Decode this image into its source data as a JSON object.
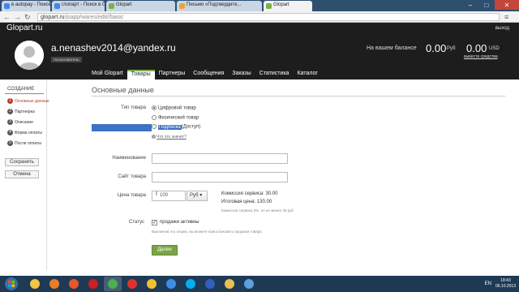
{
  "browser": {
    "tabs": [
      {
        "title": "в autopay - Поиск в Google",
        "color": "#4285f4",
        "active": false
      },
      {
        "title": "глопарт - Поиск в Google",
        "color": "#4285f4",
        "active": false
      },
      {
        "title": "Glopart",
        "color": "#7ab04d",
        "active": false
      },
      {
        "title": "Письмо «Подтвердите...",
        "color": "#e8a33b",
        "active": false
      },
      {
        "title": "Glopart",
        "color": "#7ab04d",
        "active": true
      }
    ],
    "url_host": "glopart.ru",
    "url_path": "/jsapp/wares/edit//basic"
  },
  "site": {
    "logo": "Glopart.ru",
    "logout": "выход",
    "username": "a.nenashev2014@yandex.ru",
    "role": "пользователь",
    "balance_label": "На вашем балансе",
    "balance_rub": "0.00",
    "balance_rub_cur": "Руб",
    "balance_usd": "0.00",
    "balance_usd_cur": "USD",
    "withdraw": "вывести средства",
    "nav": [
      {
        "label": "Мой Glopart",
        "active": false
      },
      {
        "label": "Товары",
        "active": true
      },
      {
        "label": "Партнеры",
        "active": false
      },
      {
        "label": "Сообщения",
        "active": false
      },
      {
        "label": "Заказы",
        "active": false
      },
      {
        "label": "Статистика",
        "active": false
      },
      {
        "label": "Каталог",
        "active": false
      }
    ]
  },
  "sidebar": {
    "title": "СОЗДАНИЕ",
    "steps": [
      {
        "num": "1",
        "label": "Основные данные",
        "active": true
      },
      {
        "num": "2",
        "label": "Партнерка",
        "active": false
      },
      {
        "num": "3",
        "label": "Описание",
        "active": false
      },
      {
        "num": "4",
        "label": "Форма оплаты",
        "active": false
      },
      {
        "num": "5",
        "label": "После оплаты",
        "active": false
      }
    ],
    "save_label": "Сохранить",
    "cancel_label": "Отмена"
  },
  "form": {
    "section_title": "Основные данные",
    "type_label": "Тип товара",
    "type_options": [
      {
        "label": "Цифровой товар",
        "selected": true
      },
      {
        "label": "Физический товар",
        "selected": false
      }
    ],
    "subscription_label": "Подписка",
    "subscription_suffix": "(Доступ)",
    "what_link": "Что это значит?",
    "name_label": "Наименование",
    "site_label": "Сайт товара",
    "price_label": "Цена товара",
    "price_value": "100",
    "currency": "Руб",
    "fee": "Комиссия сервиса: 30.00",
    "total": "Итоговая цена: 130.00",
    "fee_note": "Комиссия сервиса 3%, но не менее 30 руб",
    "status_label": "Статус",
    "sales_active_label": "продажи активны",
    "sales_note": "Выключив эту опцию, вы можете приостановить продажи товара",
    "next_label": "Далее"
  },
  "taskbar": {
    "lang": "EN",
    "time": "18:43",
    "date": "06.10.2013",
    "apps": [
      {
        "name": "explorer-icon",
        "color": "#f4c542"
      },
      {
        "name": "media-icon",
        "color": "#e87d2b"
      },
      {
        "name": "firefox-icon",
        "color": "#e8572b"
      },
      {
        "name": "opera-icon",
        "color": "#cc1f1f"
      },
      {
        "name": "chrome-icon",
        "color": "#4caf50"
      },
      {
        "name": "yandex-icon",
        "color": "#e03030"
      },
      {
        "name": "yandex-browser-icon",
        "color": "#f0c030"
      },
      {
        "name": "ie-icon",
        "color": "#3a8ee6"
      },
      {
        "name": "skype-icon",
        "color": "#00aff0"
      },
      {
        "name": "media-player-icon",
        "color": "#3060c0"
      },
      {
        "name": "folder-icon",
        "color": "#e8c050"
      },
      {
        "name": "app-icon",
        "color": "#5ba0e0"
      }
    ]
  }
}
